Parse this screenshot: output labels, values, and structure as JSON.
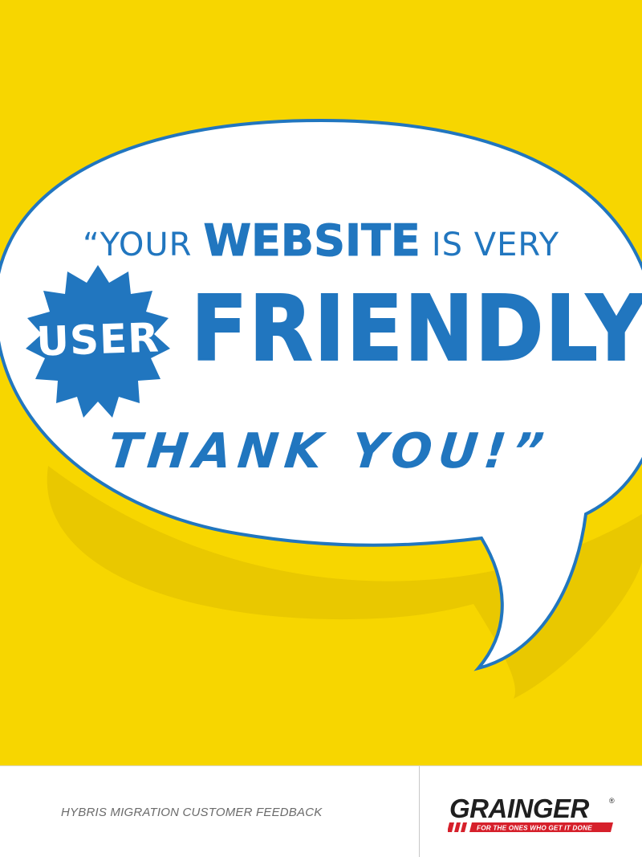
{
  "quote": {
    "open_part": "“YOUR",
    "emphasis": "WEBSITE",
    "middle_part": "IS VERY",
    "badge_text": "USER",
    "headline": "FRIENDLY",
    "closing": "THANK YOU!”"
  },
  "footer": {
    "caption": "HYBRIS MIGRATION CUSTOMER FEEDBACK"
  },
  "brand": {
    "name": "GRAINGER",
    "tagline": "FOR THE ONES WHO GET IT DONE",
    "registered_mark": "®"
  },
  "colors": {
    "background_yellow": "#f7d600",
    "shadow_yellow": "#e9c800",
    "brand_blue": "#2176bf",
    "bubble_white": "#ffffff",
    "logo_red": "#d6202b",
    "logo_dark": "#1f1f1f",
    "caption_gray": "#6b6b6b"
  },
  "icons": {
    "bubble": "speech-bubble",
    "badge": "starburst-badge"
  }
}
